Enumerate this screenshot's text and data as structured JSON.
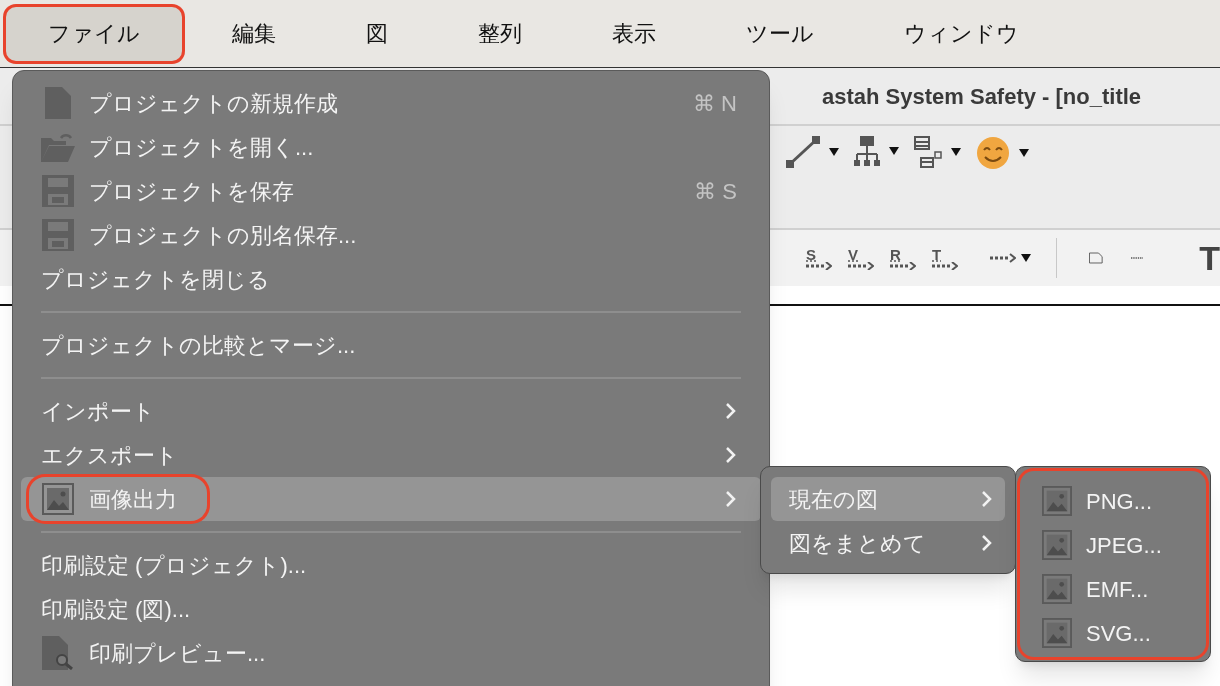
{
  "menu_bar": [
    {
      "label": "ファイル",
      "selected": true,
      "annotated": true
    },
    {
      "label": "編集",
      "selected": false,
      "annotated": false
    },
    {
      "label": "図",
      "selected": false,
      "annotated": false
    },
    {
      "label": "整列",
      "selected": false,
      "annotated": false
    },
    {
      "label": "表示",
      "selected": false,
      "annotated": false
    },
    {
      "label": "ツール",
      "selected": false,
      "annotated": false
    },
    {
      "label": "ウィンドウ",
      "selected": false,
      "annotated": false
    }
  ],
  "window": {
    "title": "astah System Safety - [no_title"
  },
  "toolbar_1": [
    {
      "kind": "line"
    },
    {
      "kind": "tree"
    },
    {
      "kind": "list"
    },
    {
      "kind": "smiley"
    }
  ],
  "toolbar_2": [
    {
      "kind": "letter-connector",
      "label": "S"
    },
    {
      "kind": "letter-connector",
      "label": "V"
    },
    {
      "kind": "letter-connector",
      "label": "R"
    },
    {
      "kind": "letter-connector",
      "label": "T"
    },
    {
      "kind": "dotted-arrow"
    },
    {
      "kind": "separator"
    },
    {
      "kind": "note"
    },
    {
      "kind": "dotted-line"
    },
    {
      "kind": "text-tool",
      "label": "T"
    }
  ],
  "file_menu": [
    {
      "kind": "item",
      "label": "プロジェクトの新規作成",
      "shortcut": "⌘ N",
      "has_submenu": false,
      "selected": false,
      "annotated": false
    },
    {
      "kind": "item",
      "label": "プロジェクトを開く...",
      "has_submenu": false,
      "selected": false,
      "annotated": false
    },
    {
      "kind": "item",
      "label": "プロジェクトを保存",
      "shortcut": "⌘ S",
      "has_submenu": false,
      "selected": false,
      "annotated": false
    },
    {
      "kind": "item",
      "label": "プロジェクトの別名保存...",
      "has_submenu": false,
      "selected": false,
      "annotated": false
    },
    {
      "kind": "item",
      "label": "プロジェクトを閉じる",
      "has_submenu": false,
      "selected": false,
      "annotated": false
    },
    {
      "kind": "separator"
    },
    {
      "kind": "item",
      "label": "プロジェクトの比較とマージ...",
      "has_submenu": false,
      "selected": false,
      "annotated": false
    },
    {
      "kind": "separator"
    },
    {
      "kind": "item",
      "label": "インポート",
      "has_submenu": true,
      "selected": false,
      "annotated": false
    },
    {
      "kind": "item",
      "label": "エクスポート",
      "has_submenu": true,
      "selected": false,
      "annotated": false
    },
    {
      "kind": "item",
      "label": "画像出力",
      "has_submenu": true,
      "selected": true,
      "annotated": true
    },
    {
      "kind": "separator"
    },
    {
      "kind": "item",
      "label": "印刷設定 (プロジェクト)...",
      "has_submenu": false,
      "selected": false,
      "annotated": false
    },
    {
      "kind": "item",
      "label": "印刷設定 (図)...",
      "has_submenu": false,
      "selected": false,
      "annotated": false
    },
    {
      "kind": "item",
      "label": "印刷プレビュー...",
      "has_submenu": false,
      "selected": false,
      "annotated": false
    }
  ],
  "image_output_menu": [
    {
      "label": "現在の図",
      "has_submenu": true,
      "selected": true
    },
    {
      "label": "図をまとめて",
      "has_submenu": true,
      "selected": false
    }
  ],
  "format_menu": {
    "annotated": true,
    "items": [
      {
        "label": "PNG..."
      },
      {
        "label": "JPEG..."
      },
      {
        "label": "EMF..."
      },
      {
        "label": "SVG..."
      }
    ]
  }
}
